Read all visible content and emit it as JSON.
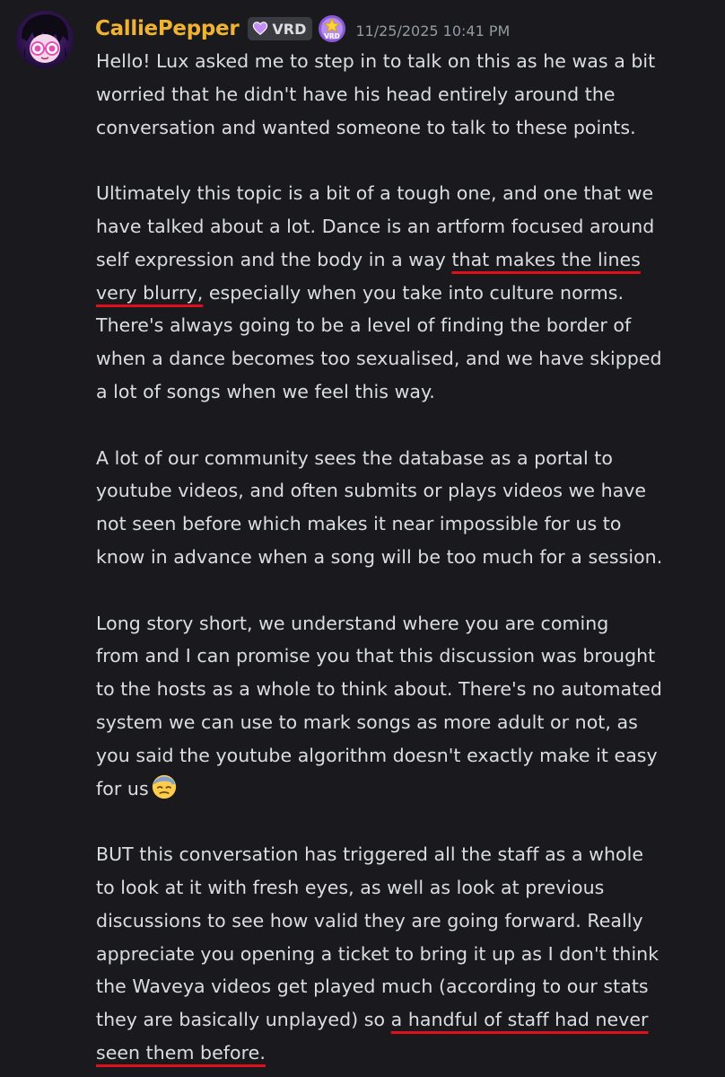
{
  "message": {
    "author": "CalliePepper",
    "tag": {
      "label": "VRD",
      "icon": "heart-icon",
      "color": "#c48ef5"
    },
    "badge": "vrd-star-badge-icon",
    "badge_text": "VRD",
    "timestamp": "11/25/2025 10:41 PM",
    "colors": {
      "author": "#f0b232",
      "text": "#dbdee1",
      "muted": "#939aa3",
      "background": "#1a1a1e",
      "underline": "#e0101a"
    },
    "paragraphs": [
      {
        "lines": [
          "Hello! Lux asked me to step in to talk on this as he was a bit",
          "worried that he didn't have his head entirely around the",
          "conversation and wanted someone to talk to these points."
        ]
      },
      {
        "lines": [
          "Ultimately this topic is a bit of a tough one, and one that we",
          "have talked about a lot. Dance is an artform focused around",
          {
            "before": "self expression and the body in a way ",
            "underlined": "that makes the lines",
            "after": ""
          },
          {
            "before": "",
            "underlined": "very blurry,",
            "after": " especially when you take into culture norms."
          },
          "There's always going to be a level of finding the border of",
          "when a dance becomes too sexualised, and we have skipped",
          "a lot of songs when we feel this way."
        ]
      },
      {
        "lines": [
          "A lot of our community sees the database as a portal to",
          "youtube videos, and often submits or plays videos we have",
          "not seen before which makes it near impossible for us to",
          "know in advance when a song will be too much for a session."
        ]
      },
      {
        "lines": [
          "Long story short, we understand where you are coming",
          "from and I can promise you that this discussion was brought",
          "to the hosts as a whole to think about. There's no automated",
          "system we can use to mark songs as more adult or not, as",
          "you said the youtube algorithm doesn't exactly make it easy",
          {
            "before": "for us",
            "underlined": "",
            "after": "",
            "emoji": "downcast-sweat-face-icon"
          }
        ]
      },
      {
        "lines": [
          "BUT this conversation has triggered all the staff as a whole",
          "to look at it with fresh eyes, as well as look at previous",
          "discussions to see how valid they are going forward. Really",
          "appreciate you opening a ticket to bring it up as I don't think",
          "the Waveya videos get played much (according to our stats",
          {
            "before": "they are basically unplayed) so ",
            "underlined": "a handful of staff had never",
            "after": ""
          },
          {
            "before": "",
            "underlined": "seen them before.",
            "after": ""
          }
        ]
      }
    ]
  }
}
